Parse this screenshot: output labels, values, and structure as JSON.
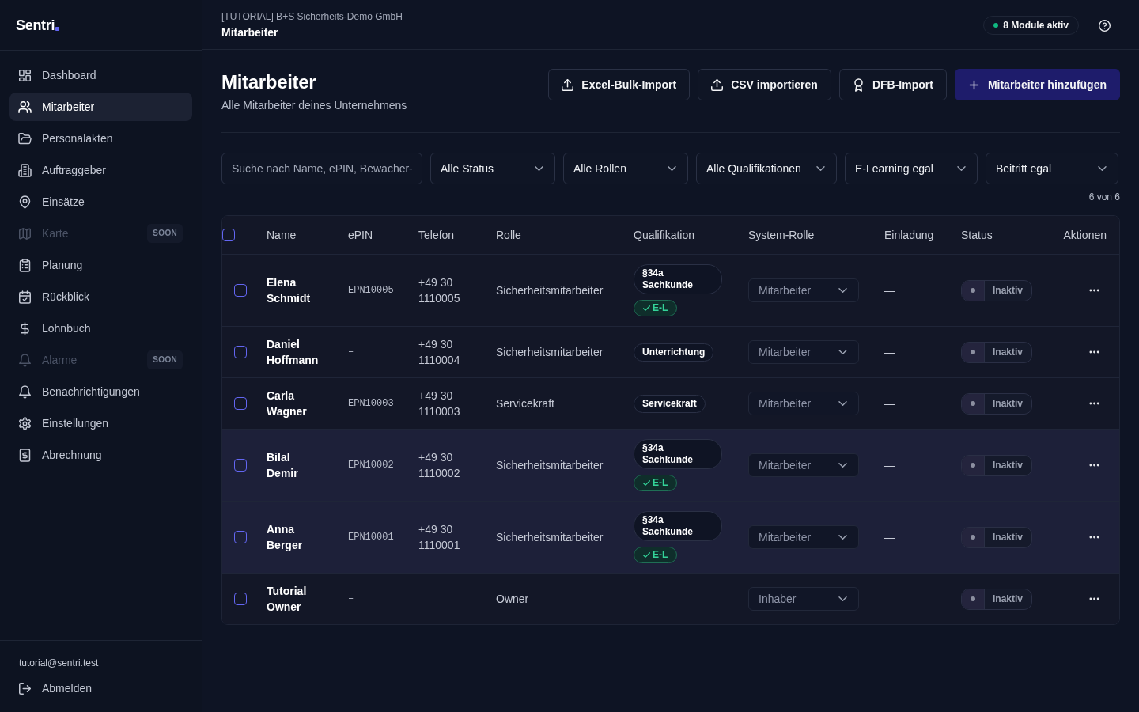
{
  "sidebar": {
    "logo": "Sentri",
    "items": [
      {
        "label": "Dashboard",
        "selected": false,
        "disabled": false
      },
      {
        "label": "Mitarbeiter",
        "selected": true,
        "disabled": false
      },
      {
        "label": "Personalakten",
        "selected": false,
        "disabled": false
      },
      {
        "label": "Auftraggeber",
        "selected": false,
        "disabled": false
      },
      {
        "label": "Einsätze",
        "selected": false,
        "disabled": false
      },
      {
        "label": "Karte",
        "selected": false,
        "disabled": true,
        "badge": "SOON"
      },
      {
        "label": "Planung",
        "selected": false,
        "disabled": false
      },
      {
        "label": "Rückblick",
        "selected": false,
        "disabled": false
      },
      {
        "label": "Lohnbuch",
        "selected": false,
        "disabled": false
      },
      {
        "label": "Alarme",
        "selected": false,
        "disabled": true,
        "badge": "SOON"
      },
      {
        "label": "Benachrichtigungen",
        "selected": false,
        "disabled": false
      },
      {
        "label": "Einstellungen",
        "selected": false,
        "disabled": false
      },
      {
        "label": "Abrechnung",
        "selected": false,
        "disabled": false
      }
    ],
    "user_email": "tutorial@sentri.test",
    "logout": "Abmelden"
  },
  "topbar": {
    "organization": "[TUTORIAL] B+S Sicherheits-Demo GmbH",
    "page": "Mitarbeiter",
    "modules_badge": "8 Module aktiv"
  },
  "page_header": {
    "title": "Mitarbeiter",
    "subtitle": "Alle Mitarbeiter deines Unternehmens",
    "actions": [
      {
        "label": "Excel-Bulk-Import",
        "kind": "outline"
      },
      {
        "label": "CSV importieren",
        "kind": "outline"
      },
      {
        "label": "DFB-Import",
        "kind": "outline"
      },
      {
        "label": "Mitarbeiter hinzufügen",
        "kind": "primary"
      }
    ]
  },
  "filters": {
    "search": {
      "placeholder": "Suche nach Name, ePIN, Bewacher-"
    },
    "selects": [
      "Alle Status",
      "Alle Rollen",
      "Alle Qualifikationen",
      "E-Learning egal",
      "Beitritt egal"
    ],
    "result_count": "6 von 6"
  },
  "table": {
    "select_all_checked": false,
    "columns": [
      "Name",
      "ePIN",
      "Telefon",
      "Rolle",
      "Qualifikation",
      "System-Rolle",
      "Einladung",
      "Status",
      "Aktionen"
    ],
    "rows": [
      {
        "checked": false,
        "highlighted": false,
        "name": "Elena Schmidt",
        "epin": "EPN10005",
        "phone": "+49 30 1110005",
        "role": "Sicherheitsmitarbeiter",
        "qualifications": [
          {
            "kind": "tag",
            "label": "§34a Sachkunde"
          },
          {
            "kind": "elearning",
            "label": "E-L"
          }
        ],
        "system_role": "Mitarbeiter",
        "invitation": "—",
        "status": {
          "label": "Inaktiv",
          "on": false
        }
      },
      {
        "checked": false,
        "highlighted": false,
        "name": "Daniel Hoffmann",
        "epin": "–",
        "phone": "+49 30 1110004",
        "role": "Sicherheitsmitarbeiter",
        "qualifications": [
          {
            "kind": "tag",
            "label": "Unterrichtung"
          }
        ],
        "system_role": "Mitarbeiter",
        "invitation": "—",
        "status": {
          "label": "Inaktiv",
          "on": false
        }
      },
      {
        "checked": false,
        "highlighted": false,
        "name": "Carla Wagner",
        "epin": "EPN10003",
        "phone": "+49 30 1110003",
        "role": "Servicekraft",
        "qualifications": [
          {
            "kind": "tag",
            "label": "Servicekraft"
          }
        ],
        "system_role": "Mitarbeiter",
        "invitation": "—",
        "status": {
          "label": "Inaktiv",
          "on": false
        }
      },
      {
        "checked": false,
        "highlighted": true,
        "name": "Bilal Demir",
        "epin": "EPN10002",
        "phone": "+49 30 1110002",
        "role": "Sicherheitsmitarbeiter",
        "qualifications": [
          {
            "kind": "tag",
            "label": "§34a Sachkunde"
          },
          {
            "kind": "elearning",
            "label": "E-L"
          }
        ],
        "system_role": "Mitarbeiter",
        "invitation": "—",
        "status": {
          "label": "Inaktiv",
          "on": false
        }
      },
      {
        "checked": false,
        "highlighted": true,
        "name": "Anna Berger",
        "epin": "EPN10001",
        "phone": "+49 30 1110001",
        "role": "Sicherheitsmitarbeiter",
        "qualifications": [
          {
            "kind": "tag",
            "label": "§34a Sachkunde"
          },
          {
            "kind": "elearning",
            "label": "E-L"
          }
        ],
        "system_role": "Mitarbeiter",
        "invitation": "—",
        "status": {
          "label": "Inaktiv",
          "on": false
        }
      },
      {
        "checked": false,
        "highlighted": false,
        "name": "Tutorial Owner",
        "epin": "–",
        "phone": "—",
        "role": "Owner",
        "qualifications": [
          {
            "kind": "none",
            "label": "—"
          }
        ],
        "system_role": "Inhaber",
        "invitation": "—",
        "status": {
          "label": "Inaktiv",
          "on": false
        }
      }
    ]
  }
}
